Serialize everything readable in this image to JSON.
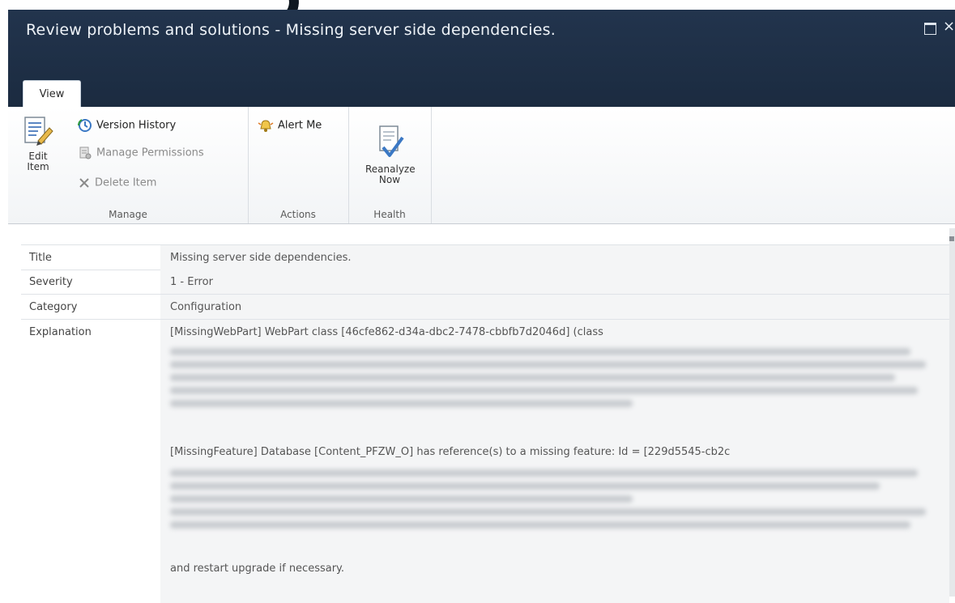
{
  "dialog": {
    "title": "Review problems and solutions - Missing server side dependencies."
  },
  "ribbon": {
    "tab_view": "View",
    "groups": {
      "manage": {
        "label": "Manage",
        "edit_item": "Edit Item",
        "version_history": "Version History",
        "manage_permissions": "Manage Permissions",
        "delete_item": "Delete Item"
      },
      "actions": {
        "label": "Actions",
        "alert_me": "Alert Me"
      },
      "health": {
        "label": "Health",
        "reanalyze_now": "Reanalyze Now"
      }
    }
  },
  "details": {
    "title": {
      "label": "Title",
      "value": "Missing server side dependencies."
    },
    "severity": {
      "label": "Severity",
      "value": "1 - Error"
    },
    "category": {
      "label": "Category",
      "value": "Configuration"
    },
    "explanation": {
      "label": "Explanation",
      "line1": "[MissingWebPart] WebPart class [46cfe862-d34a-dbc2-7478-cbbfb7d2046d] (class",
      "line2": "[MissingFeature] Database [Content_PFZW_O] has reference(s) to a missing feature: Id = [229d5545-cb2c",
      "line3": "and restart upgrade if necessary."
    }
  },
  "colors": {
    "titlebar": "#1f3048",
    "accent_blue": "#3b78c4"
  }
}
